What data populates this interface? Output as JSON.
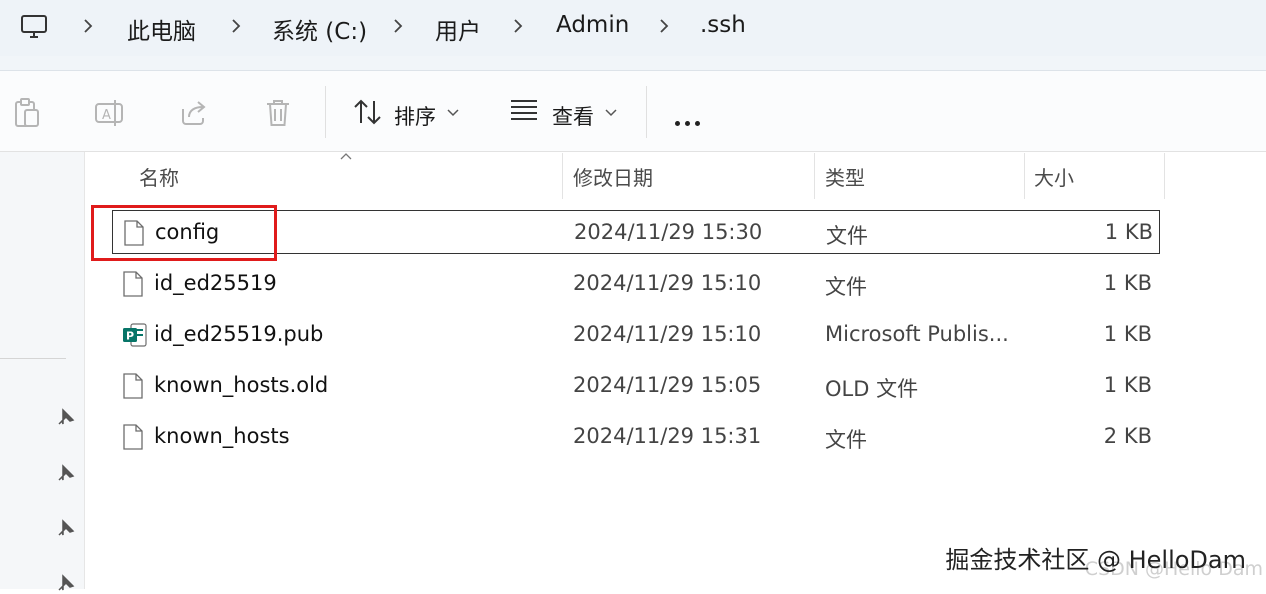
{
  "breadcrumb": [
    "此电脑",
    "系统 (C:)",
    "用户",
    "Admin",
    ".ssh"
  ],
  "toolbar": {
    "sort_label": "排序",
    "view_label": "查看"
  },
  "columns": {
    "name": "名称",
    "date": "修改日期",
    "type": "类型",
    "size": "大小"
  },
  "files": [
    {
      "name": "config",
      "date": "2024/11/29 15:30",
      "type": "文件",
      "size": "1 KB",
      "icon": "blank-file-icon"
    },
    {
      "name": "id_ed25519",
      "date": "2024/11/29 15:10",
      "type": "文件",
      "size": "1 KB",
      "icon": "blank-file-icon"
    },
    {
      "name": "id_ed25519.pub",
      "date": "2024/11/29 15:10",
      "type": "Microsoft Publis...",
      "size": "1 KB",
      "icon": "publisher-file-icon"
    },
    {
      "name": "known_hosts.old",
      "date": "2024/11/29 15:05",
      "type": "OLD 文件",
      "size": "1 KB",
      "icon": "blank-file-icon"
    },
    {
      "name": "known_hosts",
      "date": "2024/11/29 15:31",
      "type": "文件",
      "size": "2 KB",
      "icon": "blank-file-icon"
    }
  ],
  "watermark": "掘金技术社区 @ HelloDam",
  "watermark_sub": "CSDN @Hello Dam",
  "colors": {
    "highlight": "#e01b1b",
    "publisher": "#077568"
  }
}
